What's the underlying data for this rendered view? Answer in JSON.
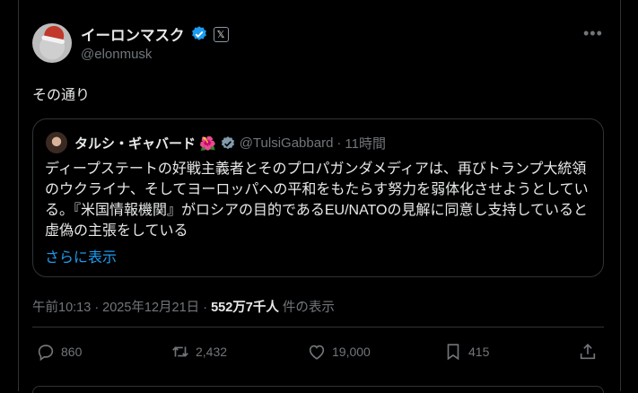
{
  "author": {
    "name": "イーロンマスク",
    "handle": "@elonmusk",
    "affiliate_badge": "𝕏"
  },
  "post": {
    "text": "その通り"
  },
  "quoted_post": {
    "name": "タルシ・ギャバード",
    "emoji": "🌺",
    "handle": "@TulsiGabbard",
    "separator": "·",
    "time": "11時間",
    "text": "ディープステートの好戦主義者とそのプロパガンダメディアは、再びトランプ大統領のウクライナ、そしてヨーロッパへの平和をもたらす努力を弱体化させようとしている。『米国情報機関』がロシアの目的であるEU/NATOの見解に同意し支持していると虚偽の主張をしている",
    "show_more": "さらに表示"
  },
  "meta": {
    "timestamp": "午前10:13 · 2025年12月21日 · ",
    "views_count": "552万7千人",
    "views_label": " 件の表示"
  },
  "actions": {
    "replies": "860",
    "reposts": "2,432",
    "likes": "19,000",
    "bookmarks": "415"
  },
  "icons": [
    "more-icon",
    "verified-icon",
    "reply-icon",
    "repost-icon",
    "like-icon",
    "bookmark-icon",
    "share-icon"
  ],
  "colors": {
    "background": "#000000",
    "text": "#e7e9ea",
    "muted": "#71767b",
    "accent": "#1d9bf0"
  }
}
